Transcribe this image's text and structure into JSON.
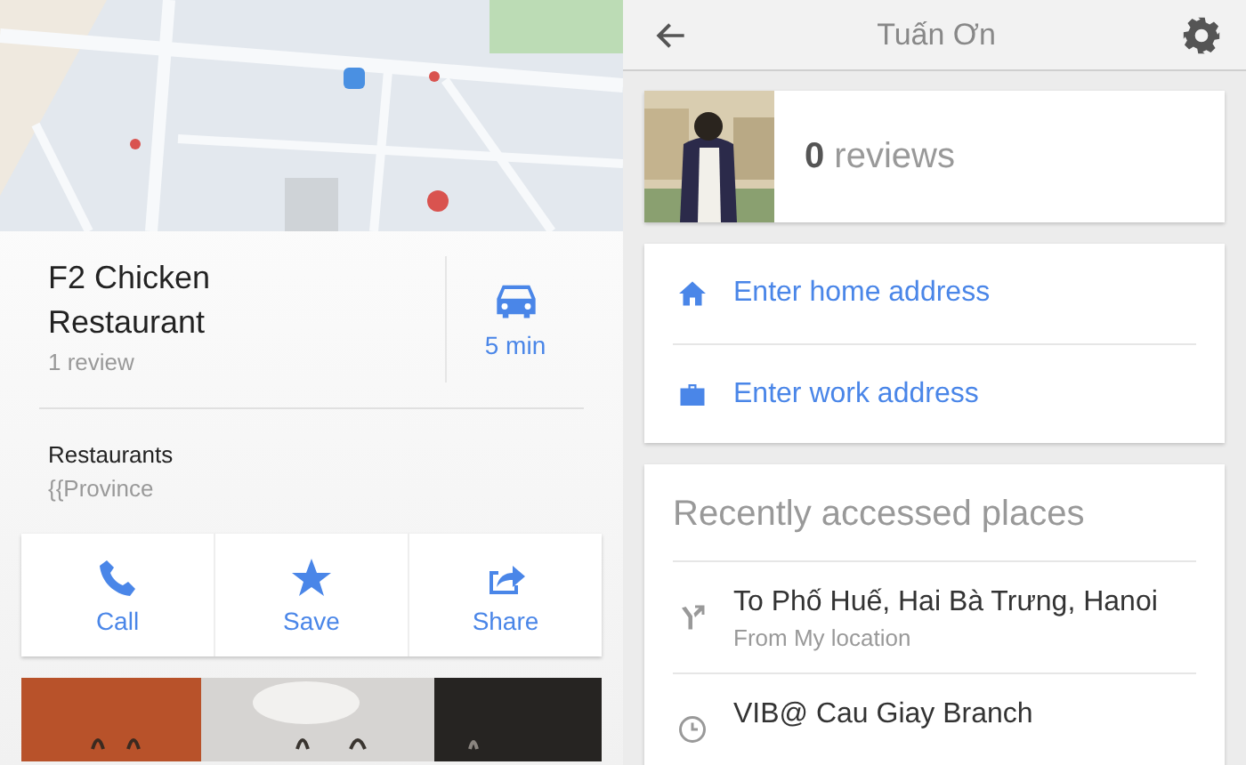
{
  "place": {
    "name": "F2 Chicken Restaurant",
    "reviews": "1 review",
    "drive_time": "5 min",
    "category": "Restaurants",
    "address": "{{Province",
    "actions": [
      {
        "kind": "call",
        "label": "Call"
      },
      {
        "kind": "save",
        "label": "Save"
      },
      {
        "kind": "share",
        "label": "Share"
      }
    ]
  },
  "profile": {
    "title": "Tuấn Ơn",
    "review_count": "0",
    "reviews_label": "reviews",
    "addresses": [
      {
        "kind": "home",
        "label": "Enter home address"
      },
      {
        "kind": "work",
        "label": "Enter work address"
      }
    ],
    "recent": {
      "title": "Recently accessed places",
      "items": [
        {
          "kind": "directions",
          "title": "To Phố Huế, Hai Bà Trưng, Hanoi",
          "subtitle": "From My location"
        },
        {
          "kind": "history",
          "title": "VIB@ Cau Giay Branch"
        }
      ]
    }
  }
}
